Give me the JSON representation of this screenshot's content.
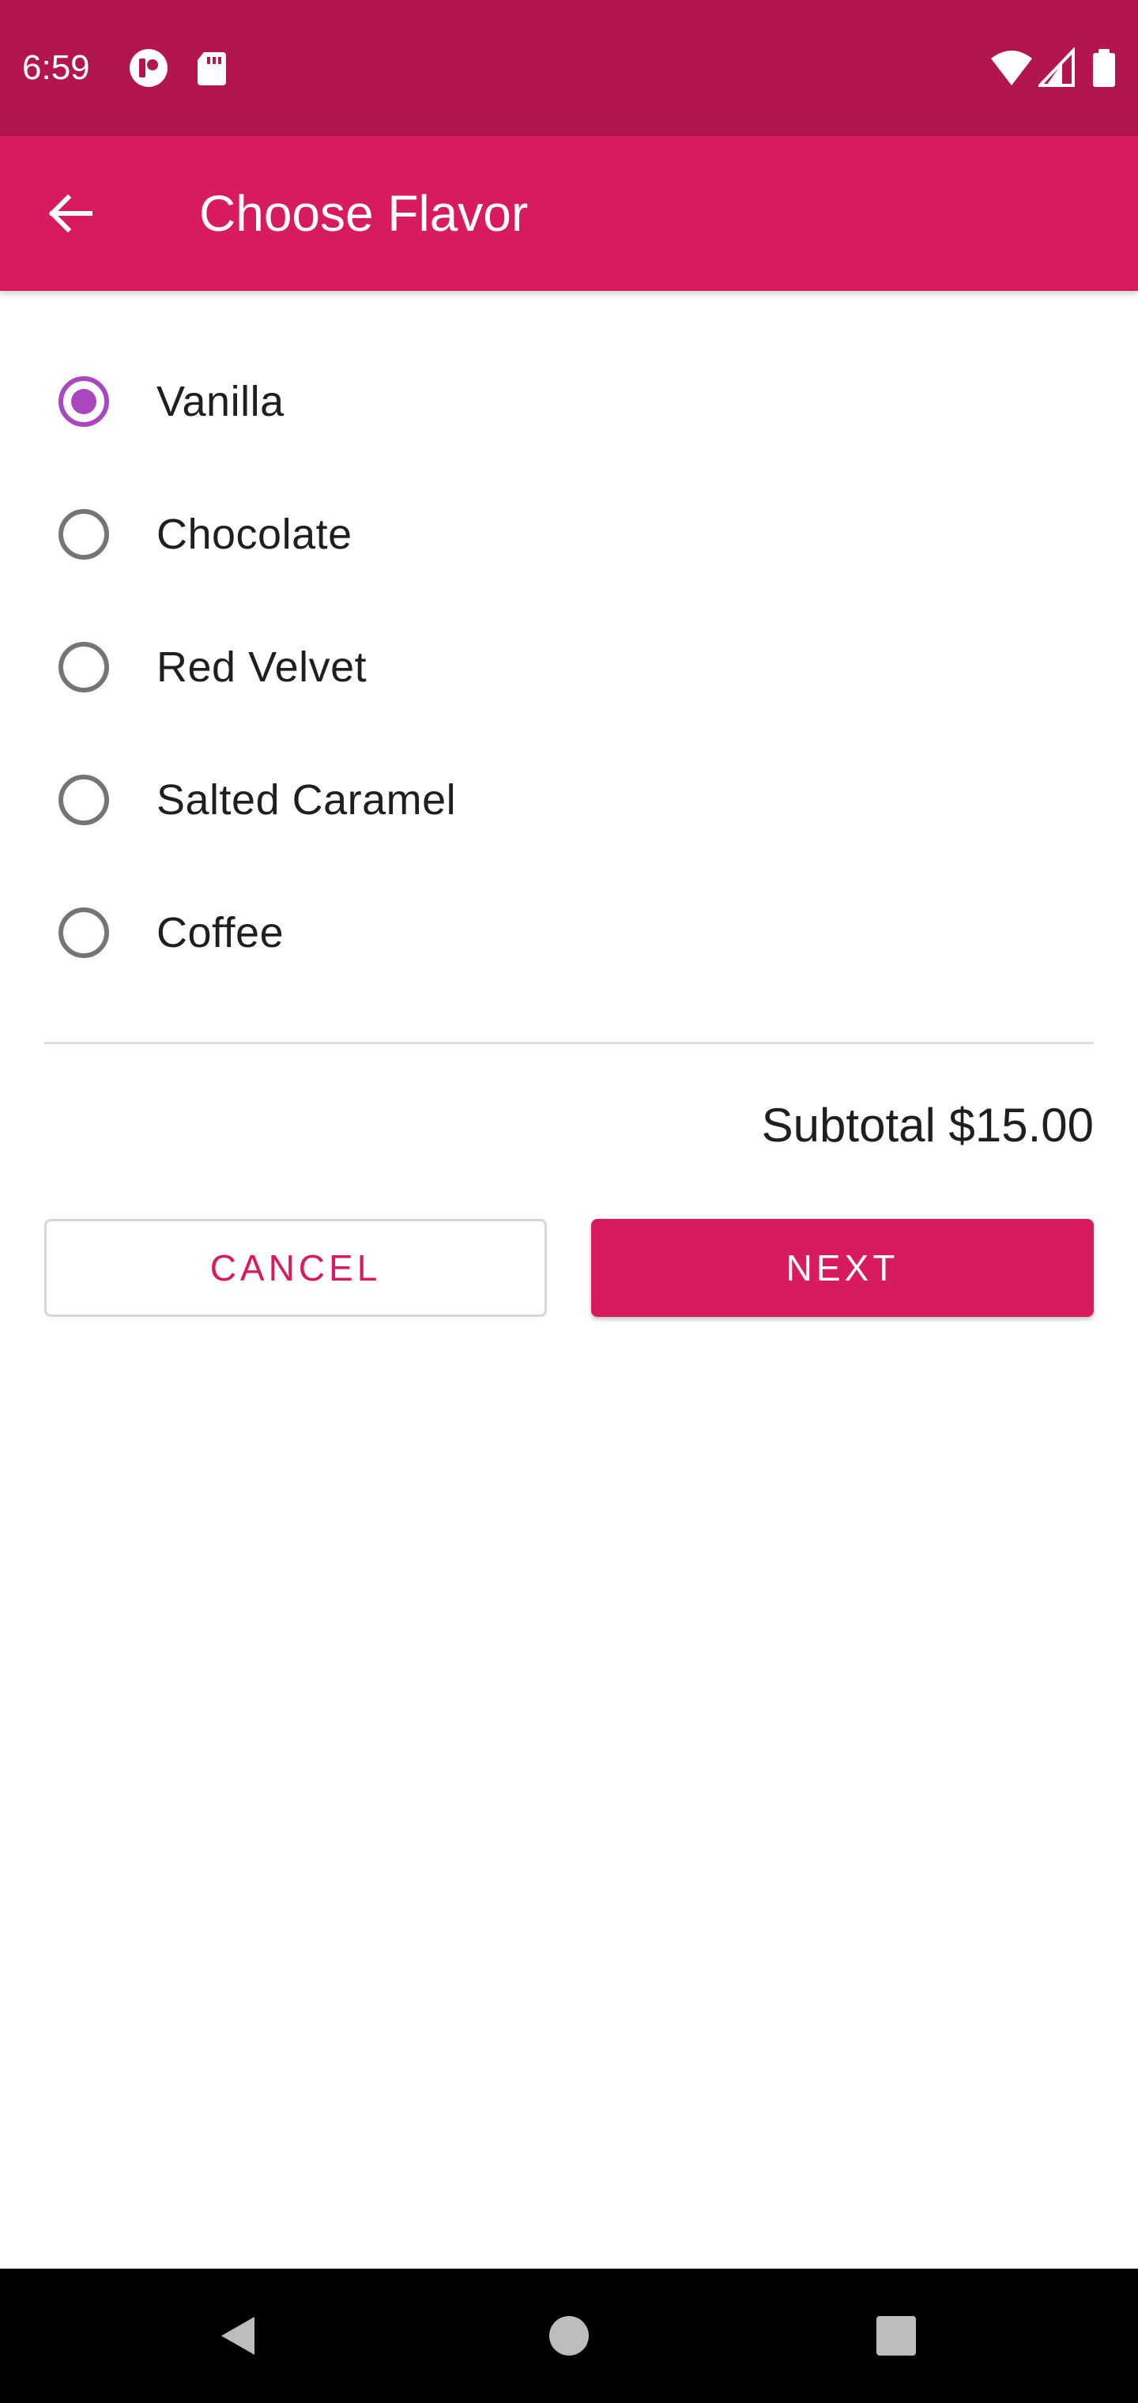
{
  "status_bar": {
    "time": "6:59",
    "icons": [
      "app-notification-icon",
      "sd-card-icon",
      "wifi-icon",
      "cell-signal-icon",
      "battery-icon"
    ]
  },
  "app_bar": {
    "title": "Choose Flavor",
    "back_icon": "arrow-back-icon"
  },
  "flavors": {
    "selected": "Vanilla",
    "options": [
      {
        "label": "Vanilla",
        "checked": true
      },
      {
        "label": "Chocolate",
        "checked": false
      },
      {
        "label": "Red Velvet",
        "checked": false
      },
      {
        "label": "Salted Caramel",
        "checked": false
      },
      {
        "label": "Coffee",
        "checked": false
      }
    ]
  },
  "summary": {
    "subtotal": "Subtotal $15.00"
  },
  "actions": {
    "cancel_label": "CANCEL",
    "next_label": "NEXT"
  },
  "nav_bar": {
    "icons": [
      "back-triangle-icon",
      "home-circle-icon",
      "recents-square-icon"
    ]
  },
  "colors": {
    "primary": "#d81b60",
    "primary_dark": "#b3164f",
    "radio_accent": "#ab47bc"
  }
}
